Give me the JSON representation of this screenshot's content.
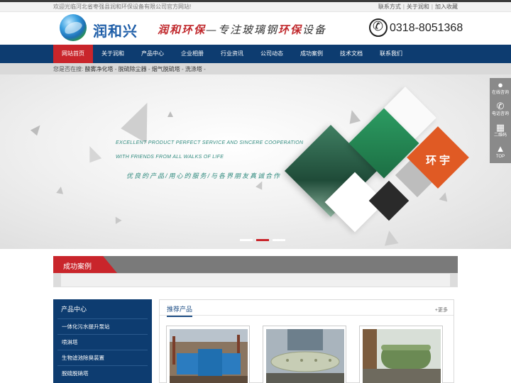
{
  "topbar": {
    "welcome": "欢迎光临河北省枣强县润和环保设备有限公司官方网站!",
    "links": [
      "联系方式",
      "关于润和",
      "加入收藏"
    ],
    "separator": "|"
  },
  "header": {
    "brand": "润和兴",
    "slogan_red1": "润和环保",
    "slogan_mid": "—专注玻璃钢",
    "slogan_red2": "环保",
    "slogan_end": "设备",
    "phone": "0318-8051368"
  },
  "nav": {
    "items": [
      "网站首页",
      "关于润和",
      "产品中心",
      "企业相册",
      "行业资讯",
      "公司动态",
      "成功案例",
      "技术文档",
      "联系我们"
    ],
    "active_index": 0
  },
  "breadcrumb": {
    "prefix": "您是否在搜:",
    "items": [
      "酸雾净化塔",
      "脱硫除尘器",
      "烟气脱硫塔",
      "洗涤塔"
    ],
    "separator": "-"
  },
  "banner": {
    "en_line1": "EXCELLENT PRODUCT PERFECT SERVICE AND SINCERE COOPERATION",
    "en_line2": "WITH FRIENDS FROM ALL WALKS OF LIFE",
    "cn_line": "优良的产品/用心的服务/与各界朋友真诚合作",
    "badge": "环宇",
    "slide_count": 3,
    "active_slide": 1
  },
  "float_bar": {
    "items": [
      {
        "icon": "qq-icon",
        "label": "在线咨询"
      },
      {
        "icon": "phone-icon",
        "label": "电话咨询"
      },
      {
        "icon": "qrcode-icon",
        "label": "二维码"
      },
      {
        "icon": "top-icon",
        "label": "TOP"
      }
    ]
  },
  "cases": {
    "title": "成功案例"
  },
  "sidebar": {
    "title": "产品中心",
    "items": [
      "一体化污水提升泵站",
      "喷淋塔",
      "生物滤池除臭装置",
      "脱硫脱硝塔"
    ]
  },
  "products": {
    "title": "推荐产品",
    "more": "+更多"
  },
  "colors": {
    "nav_bg": "#0d3c70",
    "accent_red": "#c9252b",
    "banner_text": "#2f8a7e",
    "badge_orange": "#e05a24"
  }
}
